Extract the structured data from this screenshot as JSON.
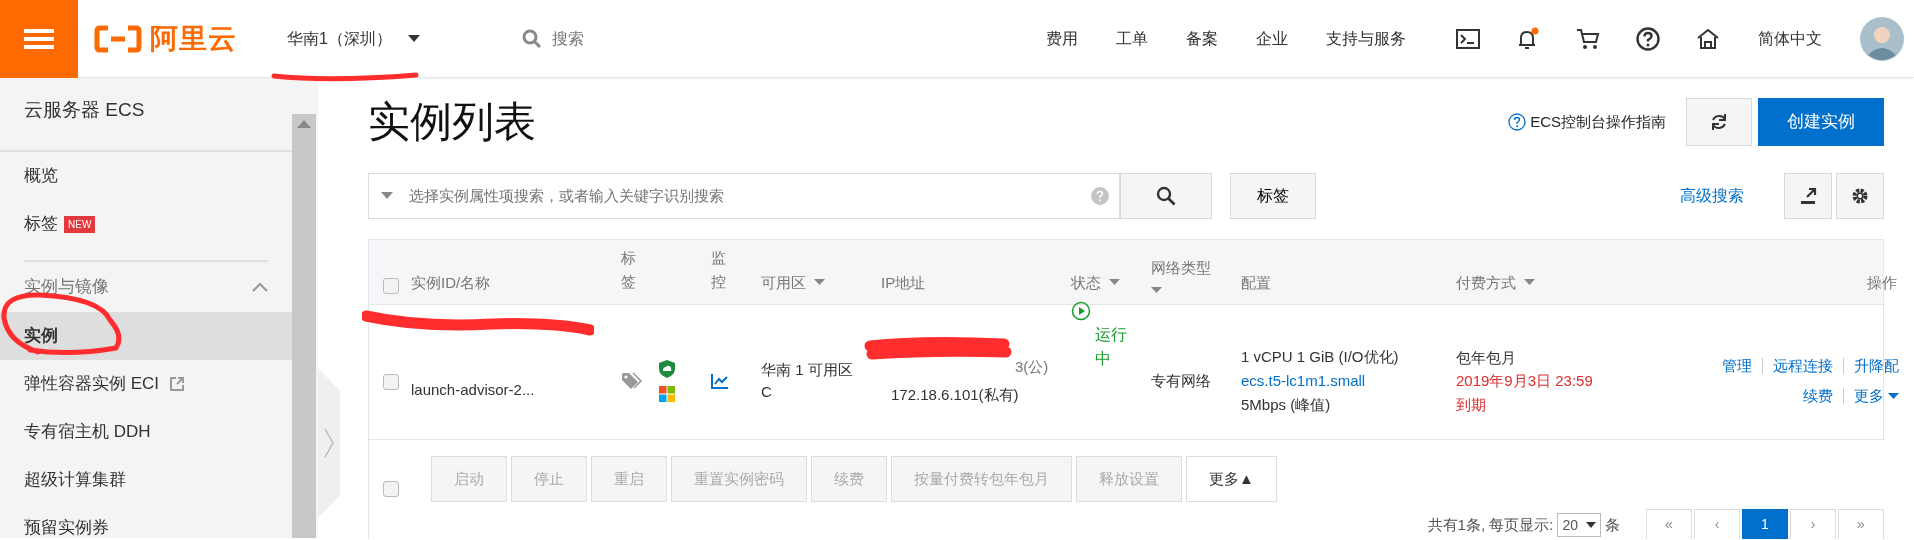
{
  "header": {
    "logo": "阿里云",
    "region": "华南1（深圳）",
    "search_placeholder": "搜索",
    "nav": [
      "费用",
      "工单",
      "备案",
      "企业",
      "支持与服务"
    ],
    "notification_dot": true,
    "language": "简体中文"
  },
  "sidebar": {
    "title": "云服务器 ECS",
    "items": [
      {
        "label": "概览",
        "selected": false
      },
      {
        "label": "标签",
        "badge": "NEW",
        "selected": false
      }
    ],
    "groups": [
      {
        "label": "实例与镜像",
        "expanded": true,
        "items": [
          {
            "label": "实例",
            "selected": true,
            "external": false
          },
          {
            "label": "弹性容器实例 ECI",
            "selected": false,
            "external": true
          },
          {
            "label": "专有宿主机 DDH",
            "selected": false,
            "external": false
          },
          {
            "label": "超级计算集群",
            "selected": false,
            "external": false
          },
          {
            "label": "预留实例券",
            "selected": false,
            "external": false
          }
        ]
      }
    ]
  },
  "page": {
    "title": "实例列表",
    "help_link": "ECS控制台操作指南",
    "create_button": "创建实例",
    "search_placeholder": "选择实例属性项搜索，或者输入关键字识别搜索",
    "tag_button": "标签",
    "advanced_search": "高级搜索"
  },
  "table": {
    "select_all_checked": false,
    "columns": [
      {
        "label": "实例ID/名称",
        "sortable": false
      },
      {
        "label": "标签",
        "sortable": false
      },
      {
        "label": "监控",
        "sortable": false
      },
      {
        "label": "可用区",
        "sortable": true
      },
      {
        "label": "IP地址",
        "sortable": false
      },
      {
        "label": "状态",
        "sortable": true
      },
      {
        "label": "网络类型",
        "sortable": true
      },
      {
        "label": "配置",
        "sortable": false
      },
      {
        "label": "付费方式",
        "sortable": true
      },
      {
        "label": "操作",
        "sortable": false
      }
    ],
    "rows": [
      {
        "checked": false,
        "name": "launch-advisor-2...",
        "zone": "华南 1 可用区 C",
        "public_ip": "3(公)",
        "private_ip": "172.18.6.101(私有)",
        "status": "运行中",
        "network": "专有网络",
        "config_spec": "1 vCPU 1 GiB (I/O优化)",
        "instance_type": "ecs.t5-lc1m1.small",
        "bandwidth": "5Mbps (峰值)",
        "billing": "包年包月",
        "expiry": "2019年9月3日 23:59 到期",
        "actions": [
          "管理",
          "远程连接",
          "升降配",
          "续费",
          "更多"
        ]
      }
    ]
  },
  "bulk": {
    "checked": false,
    "buttons": [
      {
        "label": "启动",
        "disabled": true
      },
      {
        "label": "停止",
        "disabled": true
      },
      {
        "label": "重启",
        "disabled": true
      },
      {
        "label": "重置实例密码",
        "disabled": true
      },
      {
        "label": "续费",
        "disabled": true
      },
      {
        "label": "按量付费转包年包月",
        "disabled": true
      },
      {
        "label": "释放设置",
        "disabled": true
      },
      {
        "label": "更多▲",
        "disabled": false
      }
    ]
  },
  "pagination": {
    "summary": "共有1条, 每页显示:",
    "page_size": "20",
    "unit": "条",
    "pages": [
      {
        "label": "«",
        "selected": false
      },
      {
        "label": "‹",
        "selected": false
      },
      {
        "label": "1",
        "selected": true
      },
      {
        "label": "›",
        "selected": false
      },
      {
        "label": "»",
        "selected": false
      }
    ]
  }
}
